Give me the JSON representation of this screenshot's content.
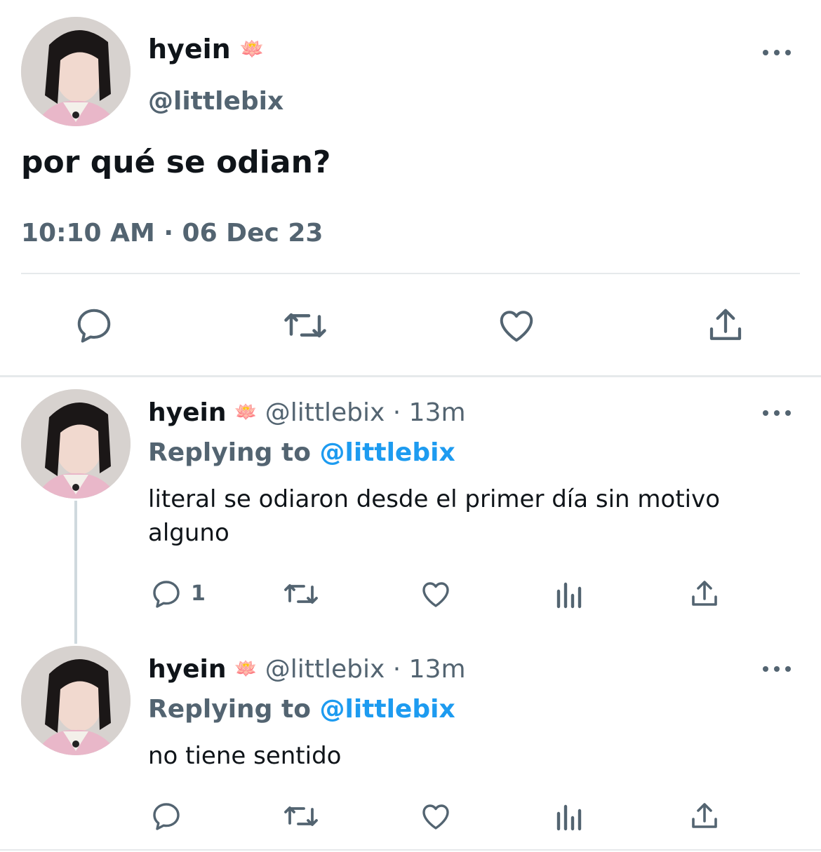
{
  "main_tweet": {
    "display_name": "hyein",
    "name_emoji": "🪷",
    "handle": "@littlebix",
    "text": "por qué se odian?",
    "timestamp": "10:10 AM · 06 Dec 23",
    "actions": [
      "reply-icon",
      "retweet-icon",
      "like-icon",
      "share-icon"
    ]
  },
  "replies": [
    {
      "display_name": "hyein",
      "name_emoji": "🪷",
      "handle": "@littlebix",
      "separator": "·",
      "time": "13m",
      "replying_prefix": "Replying to",
      "replying_to": "@littlebix",
      "text": "literal se odiaron desde el primer día sin motivo alguno",
      "reply_count": "1"
    },
    {
      "display_name": "hyein",
      "name_emoji": "🪷",
      "handle": "@littlebix",
      "separator": "·",
      "time": "13m",
      "replying_prefix": "Replying to",
      "replying_to": "@littlebix",
      "text": "no tiene sentido",
      "reply_count": ""
    }
  ],
  "colors": {
    "primary_text": "#0f1419",
    "secondary_text": "#536471",
    "accent": "#1d9bf0",
    "divider": "#e6e9eb"
  }
}
